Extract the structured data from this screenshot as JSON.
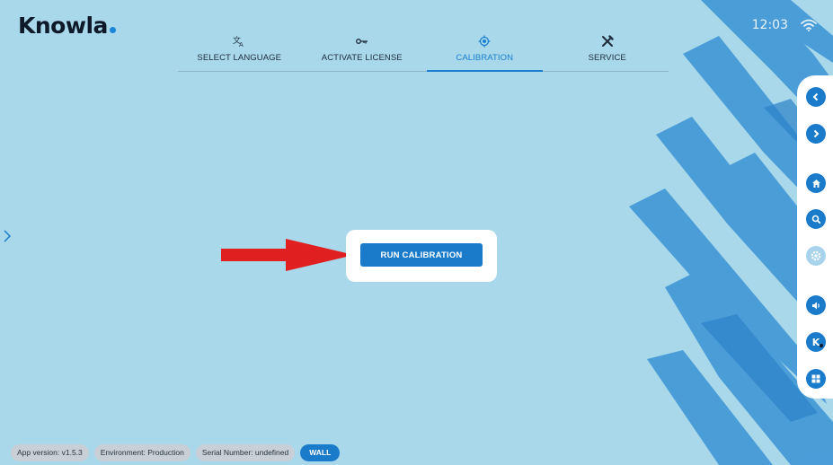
{
  "app": {
    "brand": "Knowla"
  },
  "status": {
    "time": "12:03",
    "wifi_icon": "wifi-icon"
  },
  "tabs": [
    {
      "label": "SELECT LANGUAGE",
      "icon": "translate-icon",
      "active": false
    },
    {
      "label": "ACTIVATE LICENSE",
      "icon": "key-icon",
      "active": false
    },
    {
      "label": "CALIBRATION",
      "icon": "target-icon",
      "active": true
    },
    {
      "label": "SERVICE",
      "icon": "tools-icon",
      "active": false
    }
  ],
  "main": {
    "run_calibration_label": "RUN CALIBRATION"
  },
  "side_dock": [
    {
      "icon": "back-chevron-icon",
      "enabled": true
    },
    {
      "icon": "forward-chevron-icon",
      "enabled": true
    },
    {
      "icon": "home-icon",
      "enabled": true
    },
    {
      "icon": "search-icon",
      "enabled": true
    },
    {
      "icon": "settings-icon",
      "enabled": false
    },
    {
      "icon": "volume-icon",
      "enabled": true
    },
    {
      "icon": "knowla-k-icon",
      "enabled": true
    },
    {
      "icon": "windows-icon",
      "enabled": true
    }
  ],
  "footer": {
    "app_version": "App version: v1.5.3",
    "environment": "Environment: Production",
    "serial_number": "Serial Number: undefined",
    "mode": "WALL"
  },
  "colors": {
    "background": "#a8d8ea",
    "accent": "#1a7bcb",
    "brush": "#3b93d6",
    "arrow": "#e02020"
  }
}
